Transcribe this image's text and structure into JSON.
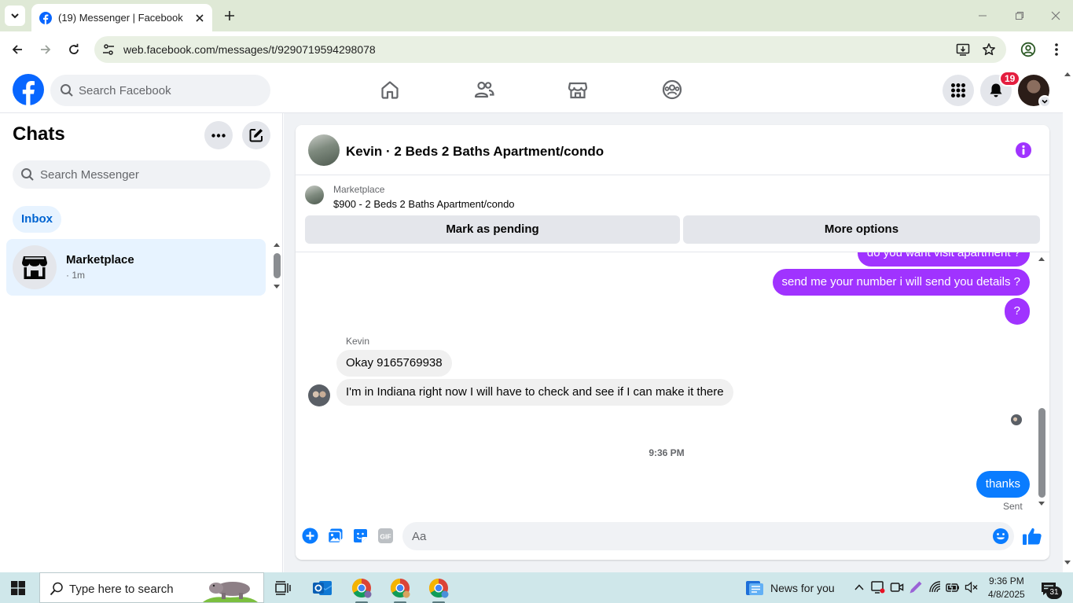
{
  "browser": {
    "tab_title": "(19) Messenger | Facebook",
    "url": "web.facebook.com/messages/t/9290719594298078"
  },
  "facebook": {
    "search_placeholder": "Search Facebook",
    "notification_count": "19",
    "brand_color": "#0866ff"
  },
  "sidebar": {
    "title": "Chats",
    "search_placeholder": "Search Messenger",
    "filter_label": "Inbox",
    "chats": [
      {
        "name": "Marketplace",
        "time": "· 1m"
      }
    ]
  },
  "conversation": {
    "title": "Kevin · 2 Beds 2 Baths Apartment/condo",
    "marketplace_label": "Marketplace",
    "listing": "$900 - 2 Beds 2 Baths Apartment/condo",
    "actions": {
      "mark_pending": "Mark as pending",
      "more_options": "More options"
    },
    "messages": {
      "out_1": "do you want visit apartment ?",
      "out_2": "send me your number i will send you details ?",
      "out_3": "?",
      "sender_name": "Kevin",
      "in_1": "Okay 9165769938",
      "in_2": "I'm in Indiana right now I will have to check and see if I can make it there",
      "time_separator": "9:36 PM",
      "out_4": "thanks",
      "status": "Sent"
    },
    "composer_placeholder": "Aa",
    "gif_label": "GIF",
    "accent_color": "#a033ff"
  },
  "taskbar": {
    "search_placeholder": "Type here to search",
    "news_label": "News for you",
    "clock_time": "9:36 PM",
    "clock_date": "4/8/2025",
    "notification_count": "31"
  }
}
